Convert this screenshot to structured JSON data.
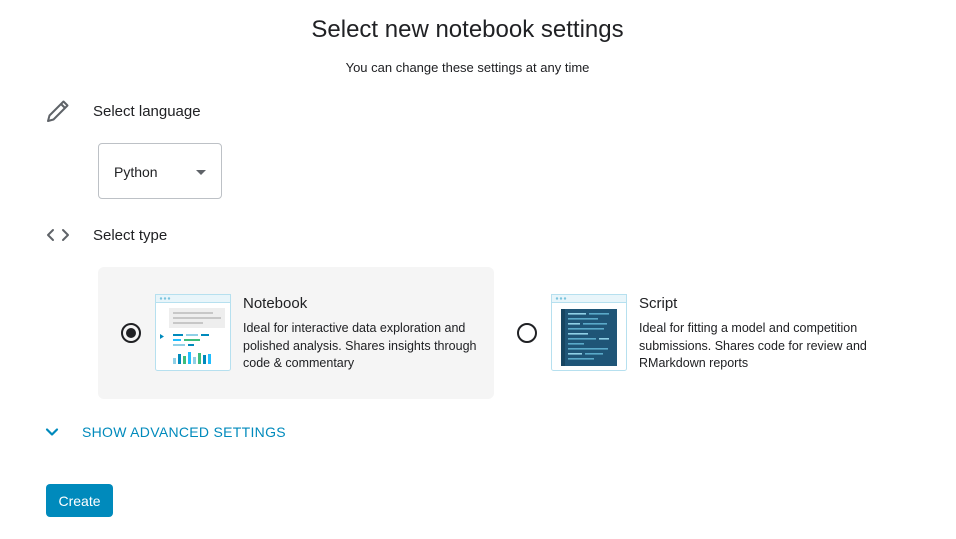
{
  "header": {
    "title": "Select new notebook settings",
    "subtitle": "You can change these settings at any time"
  },
  "language": {
    "label": "Select language",
    "icon": "pencil-icon",
    "selected": "Python"
  },
  "type": {
    "label": "Select type",
    "icon": "code-brackets-icon",
    "options": [
      {
        "title": "Notebook",
        "description": "Ideal for interactive data exploration and polished analysis. Shares insights through code & commentary",
        "selected": true,
        "icon": "notebook-thumbnail-icon"
      },
      {
        "title": "Script",
        "description": "Ideal for fitting a model and competition submissions. Shares code for review and RMarkdown reports",
        "selected": false,
        "icon": "script-thumbnail-icon"
      }
    ]
  },
  "advanced": {
    "label": "SHOW ADVANCED SETTINGS",
    "icon": "chevron-down-icon"
  },
  "actions": {
    "create_label": "Create"
  },
  "colors": {
    "accent": "#008abc",
    "selected_card_bg": "#f5f5f5",
    "text": "#202124"
  }
}
